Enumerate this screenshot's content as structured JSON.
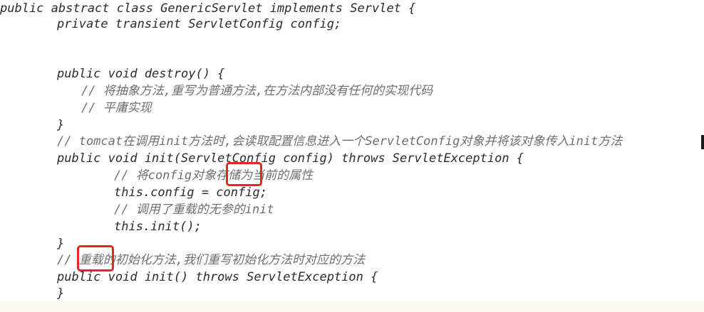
{
  "code_lines": [
    {
      "text": "public abstract class GenericServlet implements Servlet {",
      "type": "code"
    },
    {
      "text": "private transient ServletConfig config;",
      "type": "code"
    },
    {
      "text": "public void destroy() {",
      "type": "code"
    },
    {
      "text": "// 将抽象方法,重写为普通方法,在方法内部没有任何的实现代码",
      "type": "comment"
    },
    {
      "text": "// 平庸实现",
      "type": "comment"
    },
    {
      "text": "}",
      "type": "code"
    },
    {
      "text": "// tomcat在调用init方法时,会读取配置信息进入一个ServletConfig对象并将该对象传入init方法",
      "type": "comment"
    },
    {
      "text": "public void init(ServletConfig config) throws ServletException {",
      "type": "code"
    },
    {
      "text": "// 将config对象存储为当前的属性",
      "type": "comment"
    },
    {
      "text": "this.config = config;",
      "type": "code"
    },
    {
      "text": "// 调用了重载的无参的init",
      "type": "comment"
    },
    {
      "text": "this.init();",
      "type": "code"
    },
    {
      "text": "}",
      "type": "code"
    },
    {
      "text": "// 重载的初始化方法,我们重写初始化方法时对应的方法",
      "type": "comment"
    },
    {
      "text": "public void init() throws ServletException {",
      "type": "code"
    },
    {
      "text": "}",
      "type": "code"
    }
  ],
  "annotations": {
    "highlight_color": "#e8261e",
    "highlighted_words": [
      "存储",
      "重载"
    ]
  },
  "colors": {
    "code_text": "#2b2b2b",
    "comment_text": "#6f6f6f",
    "background": "#ffffff"
  }
}
